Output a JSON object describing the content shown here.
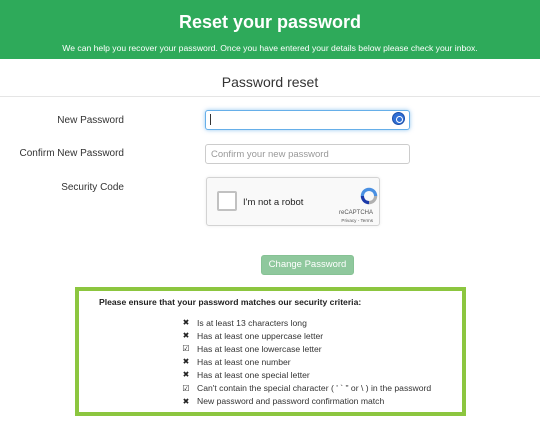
{
  "banner": {
    "title": "Reset your password",
    "subtitle": "We can help you recover your password. Once you have entered your details below please check your inbox."
  },
  "form": {
    "section_title": "Password reset",
    "new_password_label": "New Password",
    "new_password_value": "",
    "confirm_password_label": "Confirm New Password",
    "confirm_password_placeholder": "Confirm your new password",
    "security_code_label": "Security Code"
  },
  "captcha": {
    "checkbox_label": "I'm not a robot",
    "brand": "reCAPTCHA",
    "privacy": "Privacy",
    "terms": "Terms",
    "separator": " - "
  },
  "submit_button": "Change Password",
  "criteria": {
    "heading": "Please ensure that your password matches our security criteria:",
    "items": [
      {
        "icon": "✖",
        "icon_name": "cross-icon",
        "text": "Is at least 13 characters long"
      },
      {
        "icon": "✖",
        "icon_name": "cross-icon",
        "text": "Has at least one uppercase letter"
      },
      {
        "icon": "☑",
        "icon_name": "check-square-icon",
        "text": "Has at least one lowercase letter"
      },
      {
        "icon": "✖",
        "icon_name": "cross-icon",
        "text": "Has at least one number"
      },
      {
        "icon": "✖",
        "icon_name": "cross-icon",
        "text": "Has at least one special letter"
      },
      {
        "icon": "☑",
        "icon_name": "check-square-icon",
        "text": "Can't contain the special character ( ' ` \" or \\ ) in the password"
      },
      {
        "icon": "✖",
        "icon_name": "cross-icon",
        "text": "New password and password confirmation match"
      }
    ]
  },
  "colors": {
    "banner": "#2eaa5a",
    "criteria_border": "#8cc63f",
    "button": "#8fc89d"
  }
}
